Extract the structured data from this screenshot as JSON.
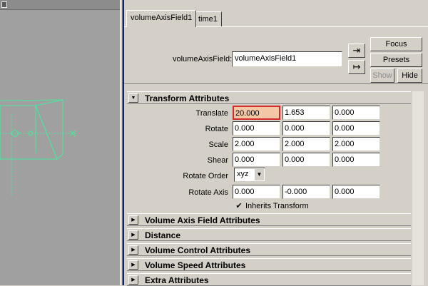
{
  "editor": {
    "tabs": [
      {
        "label": "volumeAxisField1",
        "active": true
      },
      {
        "label": "time1",
        "active": false
      }
    ],
    "node_label": "volumeAxisField:",
    "node_value": "volumeAxisField1",
    "buttons": {
      "focus": "Focus",
      "presets": "Presets",
      "show": "Show",
      "hide": "Hide"
    },
    "icons": {
      "load": "load-attributes-icon",
      "save": "save-attributes-icon"
    }
  },
  "transform": {
    "title": "Transform Attributes",
    "expanded": true,
    "translate": {
      "label": "Translate",
      "x": "20.000",
      "y": "1.653",
      "z": "0.000"
    },
    "rotate": {
      "label": "Rotate",
      "x": "0.000",
      "y": "0.000",
      "z": "0.000"
    },
    "scale": {
      "label": "Scale",
      "x": "2.000",
      "y": "2.000",
      "z": "2.000"
    },
    "shear": {
      "label": "Shear",
      "x": "0.000",
      "y": "0.000",
      "z": "0.000"
    },
    "rotate_order": {
      "label": "Rotate Order",
      "value": "xyz"
    },
    "rotate_axis": {
      "label": "Rotate Axis",
      "x": "0.000",
      "y": "-0.000",
      "z": "0.000"
    },
    "inherits": {
      "label": "Inherits Transform",
      "checked": true
    }
  },
  "sections": [
    "Volume Axis Field Attributes",
    "Distance",
    "Volume Control Attributes",
    "Volume Speed Attributes",
    "Extra Attributes"
  ],
  "colors": {
    "panel": "#d4d0c8",
    "viewport_bg": "#a0a0a0",
    "wireframe": "#48e8a0",
    "highlight_field": "#f4c7a7",
    "highlight_border": "#d22c2c",
    "blue_edge": "#0a246a"
  }
}
